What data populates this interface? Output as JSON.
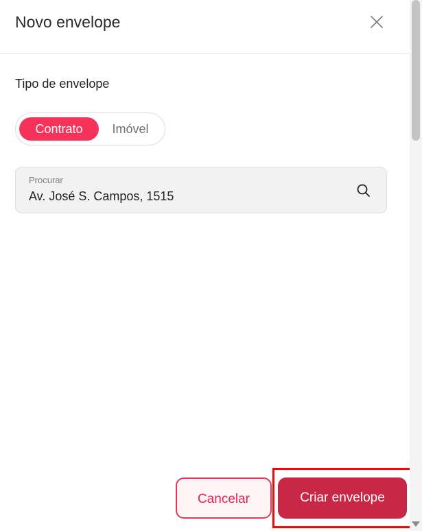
{
  "dialog": {
    "title": "Novo envelope",
    "close_icon": "close-icon"
  },
  "envelope_type": {
    "label": "Tipo de envelope",
    "options": [
      {
        "label": "Contrato",
        "selected": true
      },
      {
        "label": "Imóvel",
        "selected": false
      }
    ]
  },
  "search": {
    "label": "Procurar",
    "value": "Av. José S. Campos, 1515",
    "icon": "search-icon"
  },
  "footer": {
    "cancel_label": "Cancelar",
    "create_label": "Criar envelope"
  },
  "colors": {
    "accent": "#f7325a",
    "primary_button": "#c92746",
    "highlight": "#ff0000"
  }
}
